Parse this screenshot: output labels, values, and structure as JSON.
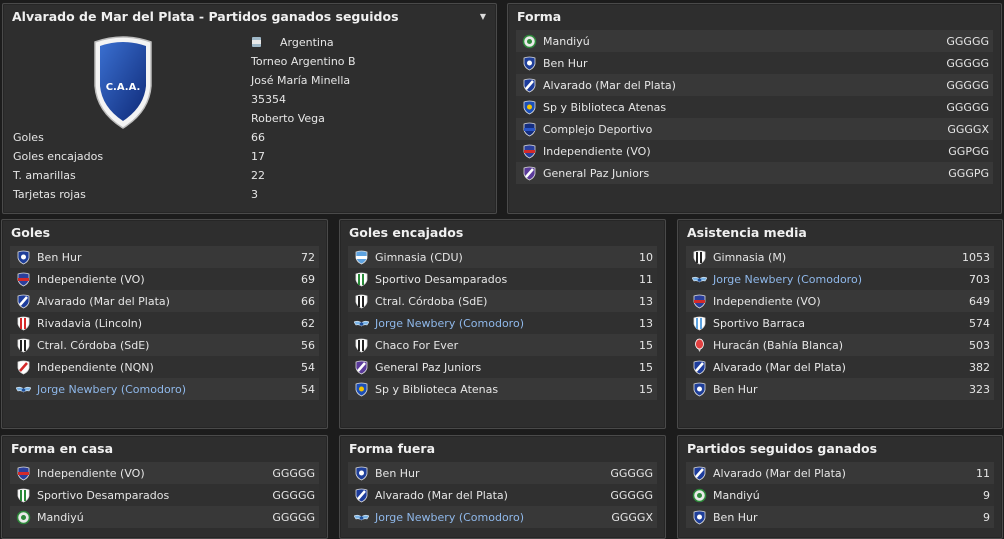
{
  "club": {
    "title": "Alvarado de Mar del Plata - Partidos ganados seguidos",
    "country": "Argentina",
    "league": "Torneo Argentino B",
    "stadium": "José María Minella",
    "capacity": "35354",
    "manager": "Roberto Vega",
    "crest_text": "C.A.A.",
    "stats": [
      {
        "label": "Goles",
        "value": "66"
      },
      {
        "label": "Goles encajados",
        "value": "17"
      },
      {
        "label": "T. amarillas",
        "value": "22"
      },
      {
        "label": "Tarjetas rojas",
        "value": "3"
      }
    ]
  },
  "forma": {
    "title": "Forma",
    "rows": [
      {
        "name": "Mandiyú",
        "value": "GGGGG",
        "badge": "green-ball",
        "link": false
      },
      {
        "name": "Ben Hur",
        "value": "GGGGG",
        "badge": "blue-white-shield",
        "link": false
      },
      {
        "name": "Alvarado (Mar del Plata)",
        "value": "GGGGG",
        "badge": "blue-stripe-shield",
        "link": false
      },
      {
        "name": "Sp y Biblioteca Atenas",
        "value": "GGGGG",
        "badge": "blue-shield",
        "link": false
      },
      {
        "name": "Complejo Deportivo",
        "value": "GGGGX",
        "badge": "dark-blue-shield",
        "link": false
      },
      {
        "name": "Independiente (VO)",
        "value": "GGPGG",
        "badge": "red-blue-shield",
        "link": false
      },
      {
        "name": "General Paz Juniors",
        "value": "GGGPG",
        "badge": "purple-white-shield",
        "link": false
      }
    ]
  },
  "goles": {
    "title": "Goles",
    "rows": [
      {
        "name": "Ben Hur",
        "value": "72",
        "badge": "blue-white-shield",
        "link": false
      },
      {
        "name": "Independiente (VO)",
        "value": "69",
        "badge": "red-blue-shield",
        "link": false
      },
      {
        "name": "Alvarado (Mar del Plata)",
        "value": "66",
        "badge": "blue-stripe-shield",
        "link": false
      },
      {
        "name": "Rivadavia (Lincoln)",
        "value": "62",
        "badge": "red-white-shield",
        "link": false
      },
      {
        "name": "Ctral. Córdoba (SdE)",
        "value": "56",
        "badge": "black-white-shield",
        "link": false
      },
      {
        "name": "Independiente (NQN)",
        "value": "54",
        "badge": "red-stripe-shield",
        "link": false
      },
      {
        "name": "Jorge Newbery (Comodoro)",
        "value": "54",
        "badge": "wings",
        "link": true
      }
    ]
  },
  "goles_encajados": {
    "title": "Goles encajados",
    "rows": [
      {
        "name": "Gimnasia (CDU)",
        "value": "10",
        "badge": "light-blue-shield",
        "link": false
      },
      {
        "name": "Sportivo Desamparados",
        "value": "11",
        "badge": "green-white-shield",
        "link": false
      },
      {
        "name": "Ctral. Córdoba (SdE)",
        "value": "13",
        "badge": "black-white-shield",
        "link": false
      },
      {
        "name": "Jorge Newbery (Comodoro)",
        "value": "13",
        "badge": "wings",
        "link": true
      },
      {
        "name": "Chaco For Ever",
        "value": "15",
        "badge": "black-white-shield",
        "link": false
      },
      {
        "name": "General Paz Juniors",
        "value": "15",
        "badge": "purple-white-shield",
        "link": false
      },
      {
        "name": "Sp y Biblioteca Atenas",
        "value": "15",
        "badge": "blue-shield",
        "link": false
      }
    ]
  },
  "asistencia": {
    "title": "Asistencia media",
    "rows": [
      {
        "name": "Gimnasia (M)",
        "value": "1053",
        "badge": "black-white-shield",
        "link": false
      },
      {
        "name": "Jorge Newbery (Comodoro)",
        "value": "703",
        "badge": "wings",
        "link": true
      },
      {
        "name": "Independiente (VO)",
        "value": "649",
        "badge": "red-blue-shield",
        "link": false
      },
      {
        "name": "Sportivo Barraca",
        "value": "574",
        "badge": "sky-white-shield",
        "link": false
      },
      {
        "name": "Huracán (Bahía Blanca)",
        "value": "503",
        "badge": "balloon",
        "link": false
      },
      {
        "name": "Alvarado (Mar del Plata)",
        "value": "382",
        "badge": "blue-stripe-shield",
        "link": false
      },
      {
        "name": "Ben Hur",
        "value": "323",
        "badge": "blue-white-shield",
        "link": false
      }
    ]
  },
  "forma_casa": {
    "title": "Forma en casa",
    "rows": [
      {
        "name": "Independiente (VO)",
        "value": "GGGGG",
        "badge": "red-blue-shield",
        "link": false
      },
      {
        "name": "Sportivo Desamparados",
        "value": "GGGGG",
        "badge": "green-white-shield",
        "link": false
      },
      {
        "name": "Mandiyú",
        "value": "GGGGG",
        "badge": "green-ball",
        "link": false
      }
    ]
  },
  "forma_fuera": {
    "title": "Forma fuera",
    "rows": [
      {
        "name": "Ben Hur",
        "value": "GGGGG",
        "badge": "blue-white-shield",
        "link": false
      },
      {
        "name": "Alvarado (Mar del Plata)",
        "value": "GGGGG",
        "badge": "blue-stripe-shield",
        "link": false
      },
      {
        "name": "Jorge Newbery (Comodoro)",
        "value": "GGGGX",
        "badge": "wings",
        "link": true
      }
    ]
  },
  "seguidos": {
    "title": "Partidos seguidos ganados",
    "rows": [
      {
        "name": "Alvarado (Mar del Plata)",
        "value": "11",
        "badge": "blue-stripe-shield",
        "link": false
      },
      {
        "name": "Mandiyú",
        "value": "9",
        "badge": "green-ball",
        "link": false
      },
      {
        "name": "Ben Hur",
        "value": "9",
        "badge": "blue-white-shield",
        "link": false
      }
    ]
  }
}
